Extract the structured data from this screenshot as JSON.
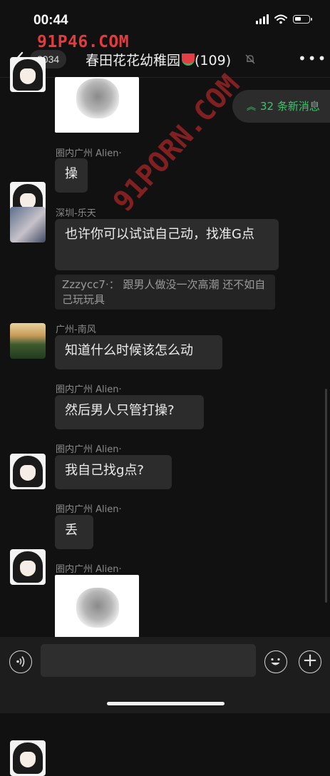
{
  "status_bar": {
    "time": "00:44"
  },
  "watermarks": {
    "top": "91P46.COM",
    "diagonal": "91PORN.COM"
  },
  "nav": {
    "unread_count": "3034",
    "title": "春田花花幼稚园",
    "member_count": "(109)",
    "more_label": "•••"
  },
  "new_messages": {
    "label": "32 条新消息"
  },
  "messages": [
    {
      "sender": "圈内广州 Alien·",
      "text": "操"
    },
    {
      "sender": "深圳-乐天",
      "text": "也许你可以试试自己动，找准G点",
      "quote": "Zzzycc7·： 跟男人做没一次高潮 还不如自己玩玩具"
    },
    {
      "sender": "广州-南风",
      "text": "知道什么时候该怎么动"
    },
    {
      "sender": "圈内广州 Alien·",
      "text": "然后男人只管打操?"
    },
    {
      "sender": "圈内广州 Alien·",
      "text": "我自己找g点?"
    },
    {
      "sender": "圈内广州 Alien·",
      "text": "丢"
    },
    {
      "sender": "圈内广州 Alien·"
    }
  ],
  "colors": {
    "accent_green": "#3ec36c",
    "bubble": "#2c2c2c",
    "background": "#111111"
  }
}
